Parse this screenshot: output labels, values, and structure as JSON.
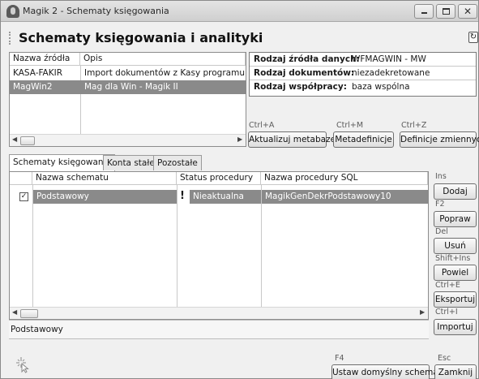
{
  "window": {
    "title": "Magik 2 - Schematy księgowania"
  },
  "heading": "Schematy księgowania i analityki",
  "sources": {
    "columns": [
      "Nazwa źródła",
      "Opis"
    ],
    "rows": [
      {
        "name": "KASA-FAKIR",
        "desc": "Import dokumentów z Kasy programu WF-Fakir",
        "selected": false
      },
      {
        "name": "MagWin2",
        "desc": "Mag dla Win - Magik II",
        "selected": true
      }
    ]
  },
  "details": {
    "source_type_label": "Rodzaj źródła danych:",
    "source_type_value": "WFMAGWIN - MW",
    "doc_type_label": "Rodzaj dokumentów:",
    "doc_type_value": "niezadekretowane",
    "coop_label": "Rodzaj współpracy:",
    "coop_value": "baza wspólna"
  },
  "top_actions": [
    {
      "hint": "Ctrl+A",
      "label": "Aktualizuj metabazę"
    },
    {
      "hint": "Ctrl+M",
      "label": "Metadefinicje"
    },
    {
      "hint": "Ctrl+Z",
      "label": "Definicje zmiennych"
    }
  ],
  "tabs": [
    "Schematy księgowania",
    "Konta stałe",
    "Pozostałe"
  ],
  "schemes": {
    "columns": [
      "Nazwa schematu",
      "Status procedury",
      "Nazwa procedury SQL"
    ],
    "rows": [
      {
        "name": "Podstawowy",
        "status": "Nieaktualna",
        "procedure": "MagikGenDekrPodstawowy10",
        "checked": true
      }
    ]
  },
  "side_actions": [
    {
      "hint": "Ins",
      "label": "Dodaj"
    },
    {
      "hint": "F2",
      "label": "Popraw"
    },
    {
      "hint": "Del",
      "label": "Usuń"
    },
    {
      "hint": "Shift+Ins",
      "label": "Powiel"
    },
    {
      "hint": "Ctrl+E",
      "label": "Eksportuj"
    },
    {
      "hint": "Ctrl+I",
      "label": "Importuj"
    }
  ],
  "status_text": "Podstawowy",
  "footer": {
    "default_hint": "F4",
    "default_label": "Ustaw domyślny schemat",
    "close_hint": "Esc",
    "close_label": "Zamknij"
  }
}
